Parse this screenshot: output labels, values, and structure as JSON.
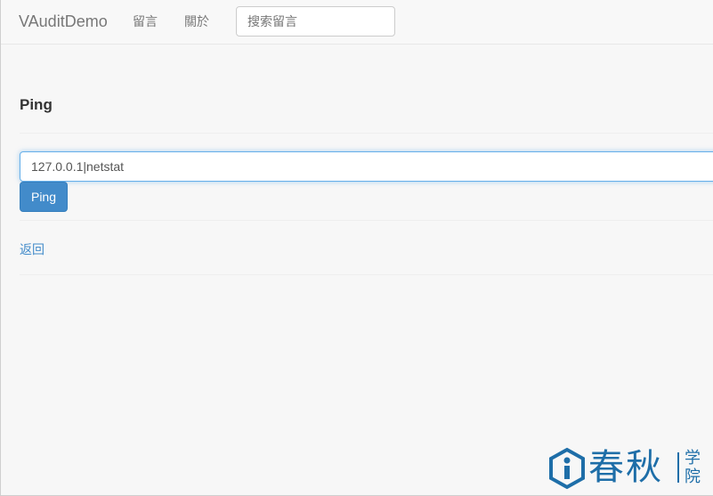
{
  "navbar": {
    "brand": "VAuditDemo",
    "links": [
      "留言",
      "關於"
    ],
    "search_placeholder": "搜索留言"
  },
  "main": {
    "title": "Ping",
    "ping_input_value": "127.0.0.1|netstat",
    "ping_button_label": "Ping",
    "back_link": "返回"
  },
  "watermark": {
    "text": "春秋",
    "small_text": "学院"
  },
  "colors": {
    "primary": "#428bca",
    "link": "#428bca",
    "watermark": "#1e6ea8"
  }
}
